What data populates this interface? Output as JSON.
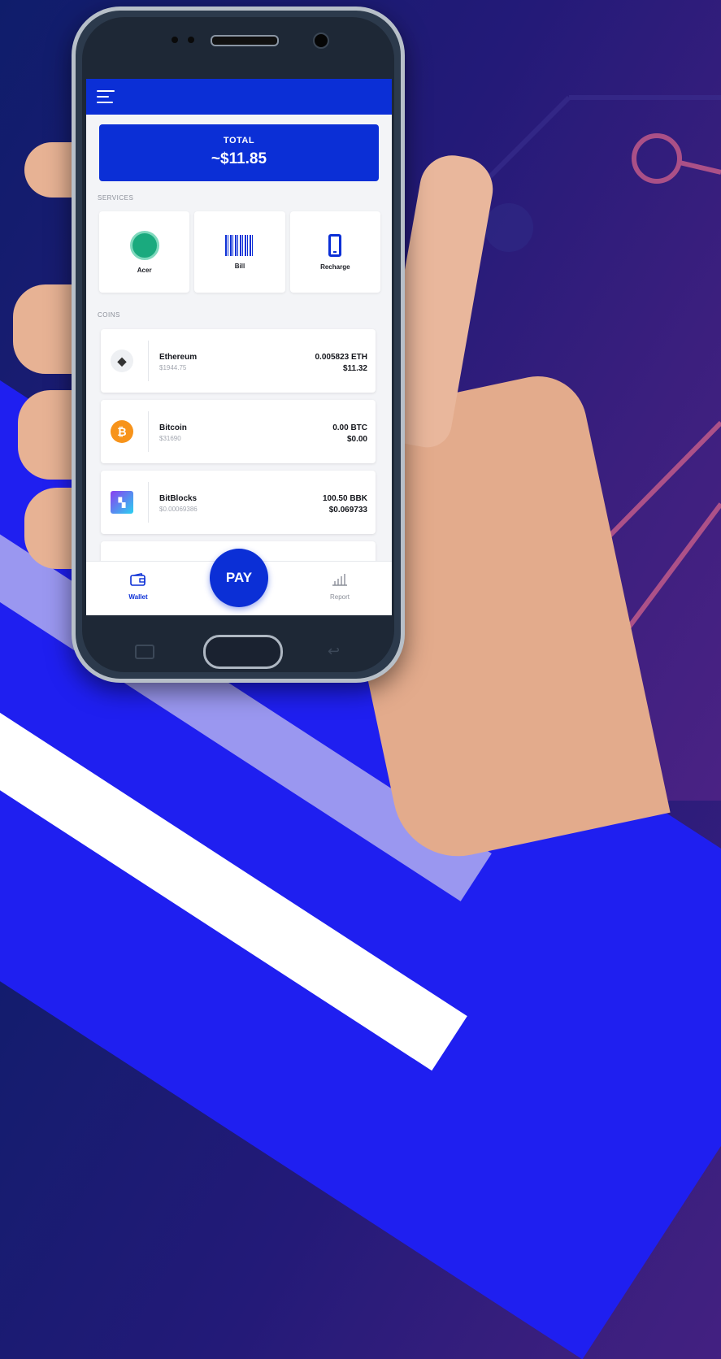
{
  "header": {
    "menu_icon": "menu-icon"
  },
  "total": {
    "label": "TOTAL",
    "value": "~$11.85"
  },
  "services": {
    "label": "SERVICES",
    "items": [
      {
        "label": "Acer",
        "icon": "acer-icon"
      },
      {
        "label": "Bill",
        "icon": "barcode-icon"
      },
      {
        "label": "Recharge",
        "icon": "mobile-phone-icon"
      }
    ]
  },
  "coins": {
    "label": "COINS",
    "items": [
      {
        "name": "Ethereum",
        "price": "$1944.75",
        "amount": "0.005823 ETH",
        "value": "$11.32",
        "icon": "ethereum-icon"
      },
      {
        "name": "Bitcoin",
        "price": "$31690",
        "amount": "0.00 BTC",
        "value": "$0.00",
        "icon": "bitcoin-icon"
      },
      {
        "name": "BitBlocks",
        "price": "$0.00069386",
        "amount": "100.50 BBK",
        "value": "$0.069733",
        "icon": "bitblocks-icon"
      }
    ]
  },
  "nav": {
    "wallet": "Wallet",
    "pay": "PAY",
    "report": "Report"
  },
  "colors": {
    "primary": "#0b2fd6",
    "background": "#f3f4f7",
    "bitcoin": "#f7931a",
    "acer": "#1aaa7e"
  }
}
